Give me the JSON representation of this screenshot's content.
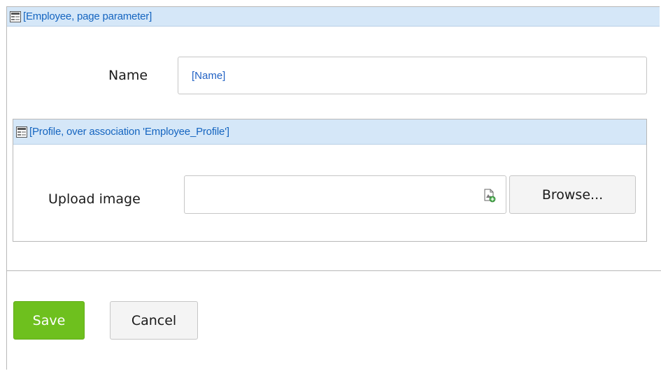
{
  "employee_dataview": {
    "title": "[Employee, page parameter]",
    "icon": "dataview-icon"
  },
  "name_field": {
    "label": "Name",
    "value": "[Name]"
  },
  "profile_dataview": {
    "title": "[Profile, over association 'Employee_Profile']",
    "icon": "dataview-icon"
  },
  "upload_field": {
    "label": "Upload image",
    "value": "",
    "icon": "file-upload-icon",
    "browse_label": "Browse..."
  },
  "actions": {
    "save_label": "Save",
    "cancel_label": "Cancel"
  },
  "colors": {
    "header_bg": "#d5e7f8",
    "title_blue": "#1565c0",
    "save_green": "#6ec01e"
  }
}
